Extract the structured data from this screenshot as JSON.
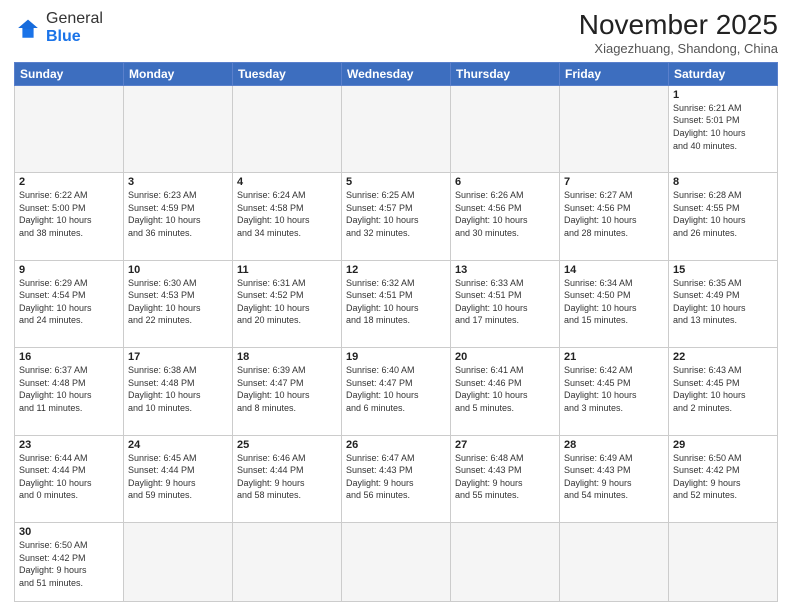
{
  "header": {
    "logo_general": "General",
    "logo_blue": "Blue",
    "month": "November 2025",
    "location": "Xiagezhuang, Shandong, China"
  },
  "weekdays": [
    "Sunday",
    "Monday",
    "Tuesday",
    "Wednesday",
    "Thursday",
    "Friday",
    "Saturday"
  ],
  "weeks": [
    [
      {
        "day": "",
        "info": ""
      },
      {
        "day": "",
        "info": ""
      },
      {
        "day": "",
        "info": ""
      },
      {
        "day": "",
        "info": ""
      },
      {
        "day": "",
        "info": ""
      },
      {
        "day": "",
        "info": ""
      },
      {
        "day": "1",
        "info": "Sunrise: 6:21 AM\nSunset: 5:01 PM\nDaylight: 10 hours\nand 40 minutes."
      }
    ],
    [
      {
        "day": "2",
        "info": "Sunrise: 6:22 AM\nSunset: 5:00 PM\nDaylight: 10 hours\nand 38 minutes."
      },
      {
        "day": "3",
        "info": "Sunrise: 6:23 AM\nSunset: 4:59 PM\nDaylight: 10 hours\nand 36 minutes."
      },
      {
        "day": "4",
        "info": "Sunrise: 6:24 AM\nSunset: 4:58 PM\nDaylight: 10 hours\nand 34 minutes."
      },
      {
        "day": "5",
        "info": "Sunrise: 6:25 AM\nSunset: 4:57 PM\nDaylight: 10 hours\nand 32 minutes."
      },
      {
        "day": "6",
        "info": "Sunrise: 6:26 AM\nSunset: 4:56 PM\nDaylight: 10 hours\nand 30 minutes."
      },
      {
        "day": "7",
        "info": "Sunrise: 6:27 AM\nSunset: 4:56 PM\nDaylight: 10 hours\nand 28 minutes."
      },
      {
        "day": "8",
        "info": "Sunrise: 6:28 AM\nSunset: 4:55 PM\nDaylight: 10 hours\nand 26 minutes."
      }
    ],
    [
      {
        "day": "9",
        "info": "Sunrise: 6:29 AM\nSunset: 4:54 PM\nDaylight: 10 hours\nand 24 minutes."
      },
      {
        "day": "10",
        "info": "Sunrise: 6:30 AM\nSunset: 4:53 PM\nDaylight: 10 hours\nand 22 minutes."
      },
      {
        "day": "11",
        "info": "Sunrise: 6:31 AM\nSunset: 4:52 PM\nDaylight: 10 hours\nand 20 minutes."
      },
      {
        "day": "12",
        "info": "Sunrise: 6:32 AM\nSunset: 4:51 PM\nDaylight: 10 hours\nand 18 minutes."
      },
      {
        "day": "13",
        "info": "Sunrise: 6:33 AM\nSunset: 4:51 PM\nDaylight: 10 hours\nand 17 minutes."
      },
      {
        "day": "14",
        "info": "Sunrise: 6:34 AM\nSunset: 4:50 PM\nDaylight: 10 hours\nand 15 minutes."
      },
      {
        "day": "15",
        "info": "Sunrise: 6:35 AM\nSunset: 4:49 PM\nDaylight: 10 hours\nand 13 minutes."
      }
    ],
    [
      {
        "day": "16",
        "info": "Sunrise: 6:37 AM\nSunset: 4:48 PM\nDaylight: 10 hours\nand 11 minutes."
      },
      {
        "day": "17",
        "info": "Sunrise: 6:38 AM\nSunset: 4:48 PM\nDaylight: 10 hours\nand 10 minutes."
      },
      {
        "day": "18",
        "info": "Sunrise: 6:39 AM\nSunset: 4:47 PM\nDaylight: 10 hours\nand 8 minutes."
      },
      {
        "day": "19",
        "info": "Sunrise: 6:40 AM\nSunset: 4:47 PM\nDaylight: 10 hours\nand 6 minutes."
      },
      {
        "day": "20",
        "info": "Sunrise: 6:41 AM\nSunset: 4:46 PM\nDaylight: 10 hours\nand 5 minutes."
      },
      {
        "day": "21",
        "info": "Sunrise: 6:42 AM\nSunset: 4:45 PM\nDaylight: 10 hours\nand 3 minutes."
      },
      {
        "day": "22",
        "info": "Sunrise: 6:43 AM\nSunset: 4:45 PM\nDaylight: 10 hours\nand 2 minutes."
      }
    ],
    [
      {
        "day": "23",
        "info": "Sunrise: 6:44 AM\nSunset: 4:44 PM\nDaylight: 10 hours\nand 0 minutes."
      },
      {
        "day": "24",
        "info": "Sunrise: 6:45 AM\nSunset: 4:44 PM\nDaylight: 9 hours\nand 59 minutes."
      },
      {
        "day": "25",
        "info": "Sunrise: 6:46 AM\nSunset: 4:44 PM\nDaylight: 9 hours\nand 58 minutes."
      },
      {
        "day": "26",
        "info": "Sunrise: 6:47 AM\nSunset: 4:43 PM\nDaylight: 9 hours\nand 56 minutes."
      },
      {
        "day": "27",
        "info": "Sunrise: 6:48 AM\nSunset: 4:43 PM\nDaylight: 9 hours\nand 55 minutes."
      },
      {
        "day": "28",
        "info": "Sunrise: 6:49 AM\nSunset: 4:43 PM\nDaylight: 9 hours\nand 54 minutes."
      },
      {
        "day": "29",
        "info": "Sunrise: 6:50 AM\nSunset: 4:42 PM\nDaylight: 9 hours\nand 52 minutes."
      }
    ],
    [
      {
        "day": "30",
        "info": "Sunrise: 6:50 AM\nSunset: 4:42 PM\nDaylight: 9 hours\nand 51 minutes."
      },
      {
        "day": "",
        "info": ""
      },
      {
        "day": "",
        "info": ""
      },
      {
        "day": "",
        "info": ""
      },
      {
        "day": "",
        "info": ""
      },
      {
        "day": "",
        "info": ""
      },
      {
        "day": "",
        "info": ""
      }
    ]
  ]
}
